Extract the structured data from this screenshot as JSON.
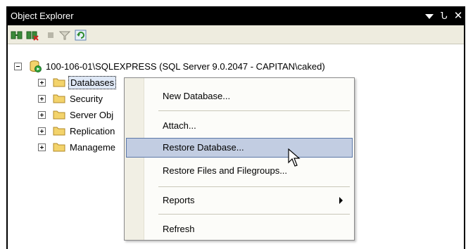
{
  "panel": {
    "title": "Object Explorer",
    "dropdown_icon": "triangle-down-icon",
    "pin_glyph": "Ն",
    "close_glyph": "✕"
  },
  "toolbar": {
    "icons": [
      "connect-icon",
      "disconnect-icon",
      "stop-icon",
      "filter-icon",
      "refresh-icon"
    ]
  },
  "tree": {
    "server": {
      "label": "100-106-01\\SQLEXPRESS (SQL Server 9.0.2047 - CAPITAN\\caked)",
      "expanded": true
    },
    "children": [
      {
        "label": "Databases",
        "selected": true
      },
      {
        "label": "Security"
      },
      {
        "label": "Server Obj"
      },
      {
        "label": "Replication"
      },
      {
        "label": "Manageme"
      }
    ]
  },
  "context_menu": {
    "items": [
      {
        "label": "New Database..."
      },
      {
        "label": "Attach..."
      },
      {
        "label": "Restore Database...",
        "highlighted": true
      },
      {
        "label": "Restore Files and Filegroups..."
      },
      {
        "label": "Reports",
        "has_submenu": true
      },
      {
        "label": "Refresh"
      }
    ]
  },
  "colors": {
    "titlebar_bg": "#000000",
    "toolbar_bg": "#eeecdf",
    "menu_highlight": "#c2cde2",
    "folder_yellow": "#f3d36b"
  }
}
